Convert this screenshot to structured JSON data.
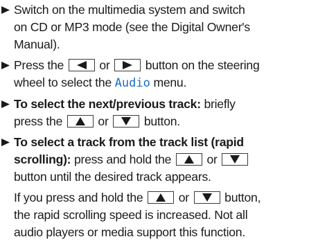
{
  "steps": [
    {
      "line1": "Switch on the multimedia system and switch",
      "line2": "on CD or MP3 mode (see the Digital Owner's",
      "line3": "Manual)."
    },
    {
      "pre": "Press the",
      "mid": "or",
      "post": "button on the steering",
      "line2_pre": "wheel to select the",
      "menu": "Audio",
      "line2_post": "menu."
    },
    {
      "bold": "To select the next/previous track:",
      "post": "briefly",
      "line2_pre": "press the",
      "mid": "or",
      "line2_post": "button."
    },
    {
      "bold1": "To select a track from the track list (rapid",
      "bold2": "scrolling):",
      "line2_post": "press and hold the",
      "mid": "or",
      "line3": "button until the desired track appears."
    }
  ],
  "note": {
    "pre": "If you press and hold the",
    "mid": "or",
    "post": "button,",
    "line2": "the rapid scrolling speed is increased. Not all",
    "line3": "audio players or media support this function."
  },
  "colors": {
    "display_text": "#1c6cc9",
    "text": "#1a1a1a",
    "button_border": "#3a3a3a"
  }
}
